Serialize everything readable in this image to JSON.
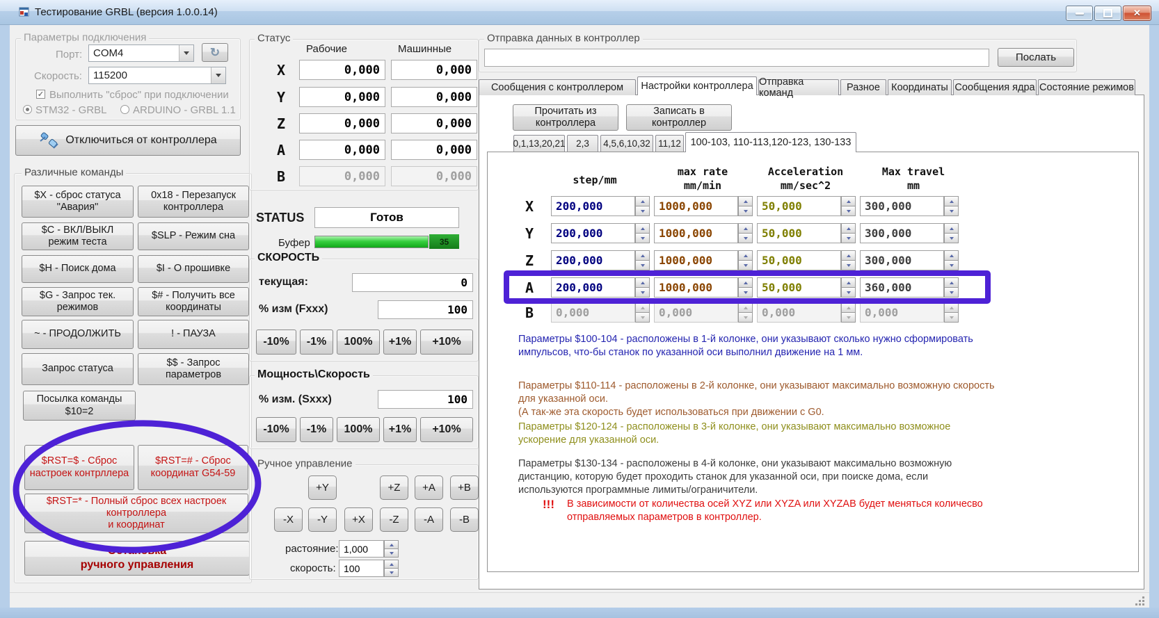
{
  "window": {
    "title": "Тестирование GRBL (версия 1.0.0.14)"
  },
  "icons": {
    "close": "✕",
    "refresh": "↻"
  },
  "colors": {
    "annotation_purple": "#4e22d6",
    "buffer_green": "#2ec936",
    "value_navy": "#000080",
    "value_brown": "#8a4500",
    "value_olive": "#7f7f00",
    "note_blue": "#2424b0",
    "note_brown": "#9e5a2d",
    "note_olive": "#8f8f1d",
    "note_black": "#3c3c3c",
    "note_red": "#e01010"
  },
  "connection": {
    "group_title": "Параметры подключения",
    "port_label": "Порт:",
    "port_value": "COM4",
    "speed_label": "Скорость:",
    "speed_value": "115200",
    "reset_checkbox_label": "Выполнить \"сброс\" при подключении",
    "radio_stm32": "STM32 - GRBL",
    "radio_arduino": "ARDUINO - GRBL 1.1",
    "disconnect_button": "Отключиться от контроллера"
  },
  "commands": {
    "group_title": "Различные команды",
    "buttons": [
      "$X - сброс статуса\n\"Авария\"",
      "0x18 - Перезапуск\nконтроллера",
      "$C - ВКЛ/ВЫКЛ\nрежим теста",
      "$SLP - Режим сна",
      "$H - Поиск дома",
      "$I - О прошивке",
      "$G - Запрос тек.\nрежимов",
      "$# - Получить все\nкоординаты",
      "~ - ПРОДОЛЖИТЬ",
      "! - ПАУЗА",
      "Запрос статуса",
      "$$ - Запрос\nпараметров",
      "Посылка команды\n$10=2"
    ],
    "reset_buttons": [
      "$RST=$ - Сброс\nнастроек контрллера",
      "$RST=# - Сброс\nкоординат G54-59",
      "$RST=* - Полный сброс всех настроек\nконтроллера\nи координат"
    ],
    "stop_button": "Остановка\nручного управления"
  },
  "status": {
    "group_title": "Статус",
    "work_header": "Рабочие",
    "machine_header": "Машинные",
    "axes": [
      {
        "axis": "X",
        "work": "0,000",
        "machine": "0,000"
      },
      {
        "axis": "Y",
        "work": "0,000",
        "machine": "0,000"
      },
      {
        "axis": "Z",
        "work": "0,000",
        "machine": "0,000"
      },
      {
        "axis": "A",
        "work": "0,000",
        "machine": "0,000"
      },
      {
        "axis": "B",
        "work": "0,000",
        "machine": "0,000"
      }
    ],
    "status_label": "STATUS",
    "status_value": "Готов",
    "buffer_label": "Буфер",
    "buffer_value": "35"
  },
  "feed": {
    "group_title": "СКОРОСТЬ",
    "current_label": "текущая:",
    "current_value": "0",
    "override_label": "% изм (Fxxx)",
    "override_value": "100",
    "buttons": [
      "-10%",
      "-1%",
      "100%",
      "+1%",
      "+10%"
    ]
  },
  "spindle": {
    "group_title": "Мощность\\Скорость",
    "override_label": "% изм. (Sxxx)",
    "override_value": "100",
    "buttons": [
      "-10%",
      "-1%",
      "100%",
      "+1%",
      "+10%"
    ]
  },
  "jog": {
    "group_title": "Ручное управление",
    "row1": [
      "+Y",
      "+Z",
      "+A",
      "+B"
    ],
    "row2": [
      "-X",
      "-Y",
      "+X",
      "-Z",
      "-A",
      "-B"
    ],
    "distance_label": "растояние:",
    "distance_value": "1,000",
    "speed_label": "скорость:",
    "speed_value": "100"
  },
  "send": {
    "group_title": "Отправка данных в контроллер",
    "input_value": "",
    "button": "Послать"
  },
  "tabs": [
    "Сообщения с контроллером",
    "Настройки контроллера",
    "Отправка команд",
    "Разное",
    "Координаты",
    "Сообщения ядра",
    "Состояние режимов"
  ],
  "settings": {
    "read_button": "Прочитать из\nконтроллера",
    "write_button": "Записать в\nконтроллер",
    "subtabs": [
      "0,1,13,20,21",
      "2,3",
      "4,5,6,10,32",
      "11,12",
      "100-103, 110-113,120-123, 130-133"
    ],
    "table": {
      "headers": [
        {
          "line1": "step/mm",
          "line2": ""
        },
        {
          "line1": "max rate",
          "line2": "mm/min"
        },
        {
          "line1": "Acceleration",
          "line2": "mm/sec^2"
        },
        {
          "line1": "Max travel",
          "line2": "mm"
        }
      ],
      "rows": [
        {
          "axis": "X",
          "step": "200,000",
          "rate": "1000,000",
          "accel": "50,000",
          "travel": "300,000"
        },
        {
          "axis": "Y",
          "step": "200,000",
          "rate": "1000,000",
          "accel": "50,000",
          "travel": "300,000"
        },
        {
          "axis": "Z",
          "step": "200,000",
          "rate": "1000,000",
          "accel": "50,000",
          "travel": "300,000"
        },
        {
          "axis": "A",
          "step": "200,000",
          "rate": "1000,000",
          "accel": "50,000",
          "travel": "360,000"
        },
        {
          "axis": "B",
          "step": "0,000",
          "rate": "0,000",
          "accel": "0,000",
          "travel": "0,000"
        }
      ]
    },
    "notes": [
      "Параметры $100-104 - расположены в 1-й колонке, они указывают сколько нужно сформировать\nимпульсов, что-бы станок по указанной оси выполнил движение на 1 мм.",
      "Параметры $110-114 - расположены в 2-й колонке, они указывают максимально возможную скорость\nдля указанной оси.\n(А так-же эта скорость будет использоваться при движении с G0.",
      "Параметры $120-124 - расположены в 3-й колонке, они указывают максимально возможное\nускорение для указанной оси.",
      "Параметры $130-134 - расположены в 4-й колонке, они указывают максимально возможную\nдистанцию, которую будет проходить станок для указанной оси, при поиске дома, если\nиспользуются программные лимиты/ограничители."
    ],
    "warning_prefix": "!!!",
    "warning": "В зависимости от количества осей XYZ или XYZA или XYZAB будет меняться количесво\nотправляемых параметров в контроллер."
  }
}
